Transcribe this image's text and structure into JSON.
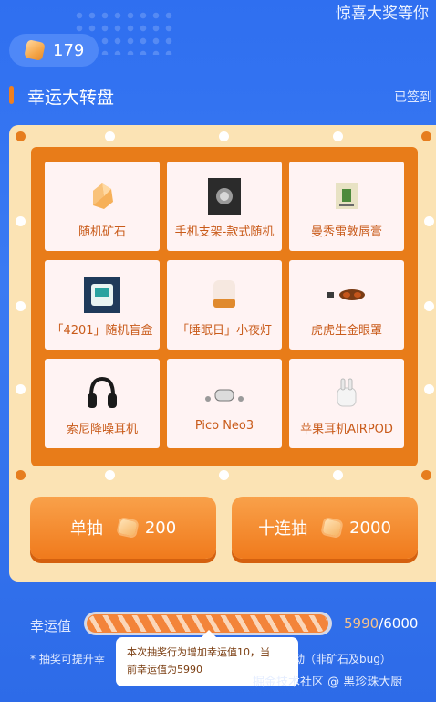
{
  "header": {
    "marquee_text": "惊喜大奖等你",
    "ore_count": "179",
    "title": "幸运大转盘",
    "signed_text": "已签到"
  },
  "prizes": [
    {
      "label": "随机矿石",
      "icon": "ore-icon"
    },
    {
      "label": "手机支架-款式随机",
      "icon": "phone-holder-icon"
    },
    {
      "label": "曼秀雷敦唇膏",
      "icon": "lip-balm-icon"
    },
    {
      "label": "「4201」随机盲盒",
      "icon": "blind-box-icon"
    },
    {
      "label": "「睡眠日」小夜灯",
      "icon": "night-light-icon"
    },
    {
      "label": "虎虎生金眼罩",
      "icon": "eye-mask-icon"
    },
    {
      "label": "索尼降噪耳机",
      "icon": "headphones-icon"
    },
    {
      "label": "Pico Neo3",
      "icon": "vr-headset-icon"
    },
    {
      "label": "苹果耳机AIRPOD",
      "icon": "airpods-icon"
    }
  ],
  "actions": {
    "single_label": "单抽",
    "single_cost": "200",
    "ten_label": "十连抽",
    "ten_cost": "2000"
  },
  "luck": {
    "label": "幸运值",
    "current": "5990",
    "separator": "/",
    "max": "6000",
    "progress_fraction": 0.998
  },
  "note": {
    "prefix": "* 抽奖可提升幸",
    "suffix": "动（非矿石及bug）"
  },
  "tooltip": {
    "line1": "本次抽奖行为增加幸运值10，当",
    "line2": "前幸运值为5990"
  },
  "watermark": "掘金技术社区 @ 黑珍珠大厨",
  "colors": {
    "background": "#2f6ff0",
    "board": "#fbe3b4",
    "frame": "#e87c19",
    "cell": "#fff3f3",
    "accent": "#f07a1c"
  }
}
